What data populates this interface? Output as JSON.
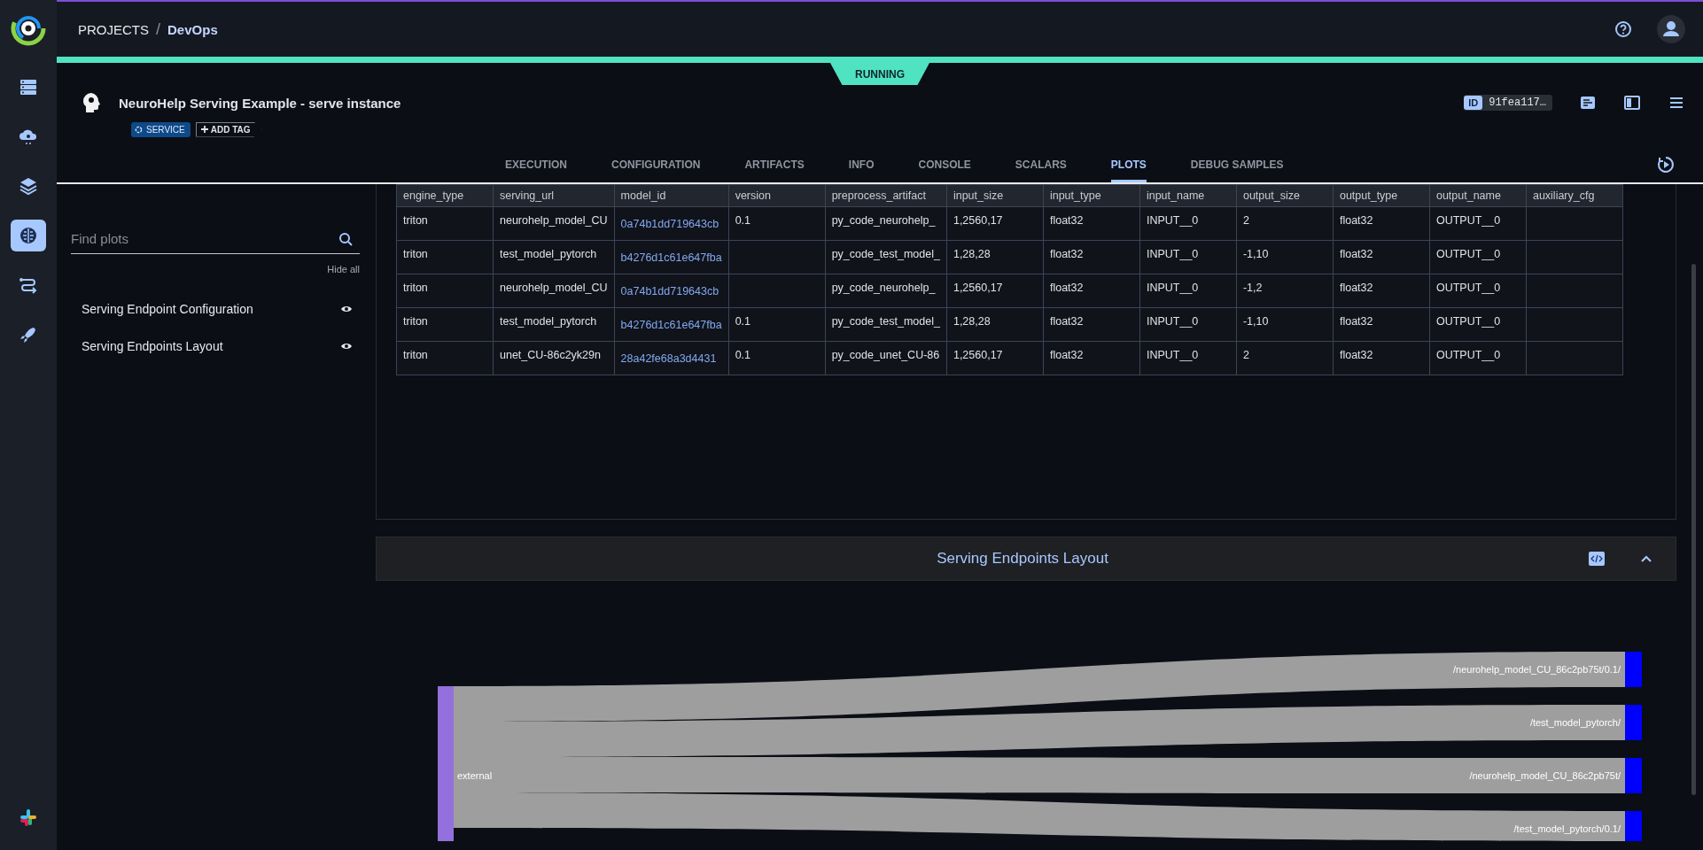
{
  "nav_rail": {
    "items": [
      {
        "kind": "server",
        "selected": false
      },
      {
        "kind": "cloud",
        "selected": false
      },
      {
        "kind": "layers",
        "selected": false
      },
      {
        "kind": "brain",
        "selected": true
      },
      {
        "kind": "flow",
        "selected": false
      },
      {
        "kind": "rocket",
        "selected": false
      }
    ]
  },
  "breadcrumb": {
    "root": "PROJECTS",
    "separator": "/",
    "current": "DevOps"
  },
  "status": "RUNNING",
  "task": {
    "title": "NeuroHelp Serving Example - serve instance",
    "tags": [
      "SERVICE"
    ],
    "add_tag": "ADD TAG",
    "id_label": "ID",
    "id_value": "91fea117…"
  },
  "tabs": [
    {
      "label": "EXECUTION",
      "selected": false
    },
    {
      "label": "CONFIGURATION",
      "selected": false
    },
    {
      "label": "ARTIFACTS",
      "selected": false
    },
    {
      "label": "INFO",
      "selected": false
    },
    {
      "label": "CONSOLE",
      "selected": false
    },
    {
      "label": "SCALARS",
      "selected": false
    },
    {
      "label": "PLOTS",
      "selected": true
    },
    {
      "label": "DEBUG SAMPLES",
      "selected": false
    }
  ],
  "plots_list": {
    "search": {
      "placeholder": "Find plots"
    },
    "hide_all": "Hide all",
    "items": [
      {
        "label": "Serving Endpoint Configuration",
        "visible": true
      },
      {
        "label": "Serving Endpoints Layout",
        "visible": true
      }
    ]
  },
  "table": {
    "columns": [
      {
        "label": "engine_type",
        "kind": "text"
      },
      {
        "label": "serving_url",
        "kind": "text"
      },
      {
        "label": "model_id",
        "kind": "link"
      },
      {
        "label": "version",
        "kind": "text"
      },
      {
        "label": "preprocess_artifact",
        "kind": "text"
      },
      {
        "label": "input_size",
        "kind": "text"
      },
      {
        "label": "input_type",
        "kind": "text"
      },
      {
        "label": "input_name",
        "kind": "text"
      },
      {
        "label": "output_size",
        "kind": "text"
      },
      {
        "label": "output_type",
        "kind": "text"
      },
      {
        "label": "output_name",
        "kind": "text"
      },
      {
        "label": "auxiliary_cfg",
        "kind": "text"
      }
    ],
    "rows": [
      [
        "triton",
        "neurohelp_model_CU",
        "0a74b1dd719643cb",
        "0.1",
        "py_code_neurohelp_",
        "1,2560,17",
        "float32",
        "INPUT__0",
        "2",
        "float32",
        "OUTPUT__0",
        null
      ],
      [
        "triton",
        "test_model_pytorch",
        "b4276d1c61e647fba",
        null,
        "py_code_test_model_",
        "1,28,28",
        "float32",
        "INPUT__0",
        "-1,10",
        "float32",
        "OUTPUT__0",
        null
      ],
      [
        "triton",
        "neurohelp_model_CU",
        "0a74b1dd719643cb",
        null,
        "py_code_neurohelp_",
        "1,2560,17",
        "float32",
        "INPUT__0",
        "-1,2",
        "float32",
        "OUTPUT__0",
        null
      ],
      [
        "triton",
        "test_model_pytorch",
        "b4276d1c61e647fba",
        "0.1",
        "py_code_test_model_",
        "1,28,28",
        "float32",
        "INPUT__0",
        "-1,10",
        "float32",
        "OUTPUT__0",
        null
      ],
      [
        "triton",
        "unet_CU-86c2yk29n",
        "28a42fe68a3d4431",
        "0.1",
        "py_code_unet_CU-86",
        "1,2560,17",
        "float32",
        "INPUT__0",
        "2",
        "float32",
        "OUTPUT__0",
        null
      ]
    ]
  },
  "layout_plot": {
    "title": "Serving Endpoints Layout",
    "expanded": true,
    "sankey": {
      "source": "external",
      "targets": [
        "/neurohelp_model_CU_86c2pb75t/0.1/",
        "/test_model_pytorch/",
        "/neurohelp_model_CU_86c2pb75t/",
        "/test_model_pytorch/0.1/"
      ]
    }
  }
}
